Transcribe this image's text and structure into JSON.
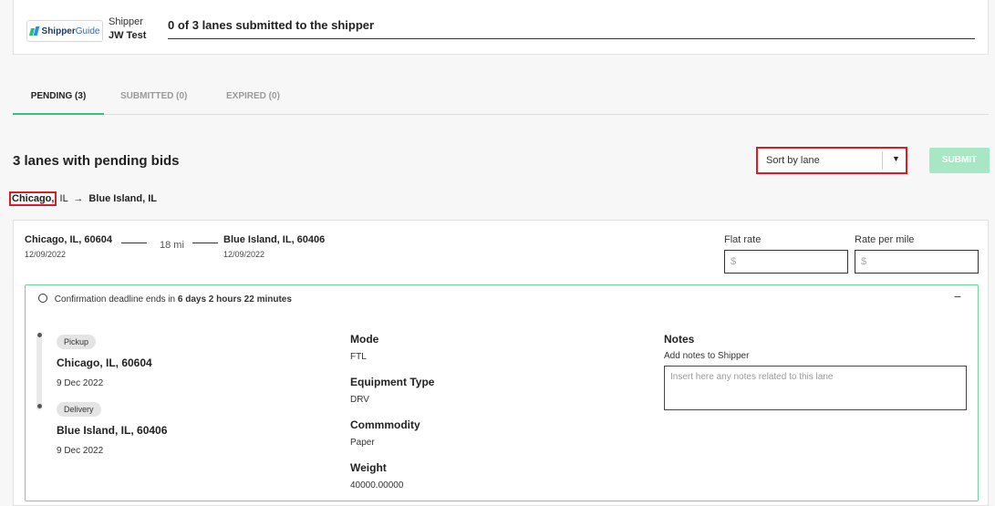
{
  "header": {
    "logo_text_bold": "Shipper",
    "logo_text_light": "Guide",
    "shipper_label": "Shipper",
    "shipper_name": "JW Test",
    "progress_text": "0 of 3 lanes submitted to the shipper"
  },
  "tabs": [
    {
      "label": "PENDING (3)",
      "active": true
    },
    {
      "label": "SUBMITTED (0)",
      "active": false
    },
    {
      "label": "EXPIRED (0)",
      "active": false
    }
  ],
  "toolbar": {
    "title": "3 lanes with pending bids",
    "sort_value": "Sort by lane",
    "submit_label": "SUBMIT"
  },
  "lane": {
    "route_origin_city": "Chicago,",
    "route_origin_state": " IL",
    "route_arrow": "→",
    "route_destination": "Blue Island, IL",
    "origin": "Chicago, IL, 60604",
    "origin_date": "12/09/2022",
    "distance": "18 mi",
    "destination": "Blue Island, IL, 60406",
    "destination_date": "12/09/2022",
    "flat_rate_label": "Flat rate",
    "flat_rate_placeholder": "$",
    "rate_per_mile_label": "Rate per mile",
    "rate_per_mile_placeholder": "$"
  },
  "confirmation": {
    "deadline_prefix": "Confirmation deadline ends in",
    "deadline_value": "6 days 2 hours 22 minutes",
    "collapse_symbol": "−",
    "pickup_label": "Pickup",
    "pickup_city": "Chicago, IL, 60604",
    "pickup_date": "9 Dec 2022",
    "delivery_label": "Delivery",
    "delivery_city": "Blue Island, IL, 60406",
    "delivery_date": "9 Dec 2022",
    "mode_label": "Mode",
    "mode_value": "FTL",
    "equipment_label": "Equipment Type",
    "equipment_value": "DRV",
    "commodity_label": "Commmodity",
    "commodity_value": "Paper",
    "weight_label": "Weight",
    "weight_value": "40000.00000",
    "notes_title": "Notes",
    "notes_sub": "Add notes to Shipper",
    "notes_placeholder": "Insert here any notes related to this lane"
  },
  "colors": {
    "accent": "#35c27a",
    "highlight": "#d21f2a",
    "submit_disabled": "#a8e7c4"
  }
}
